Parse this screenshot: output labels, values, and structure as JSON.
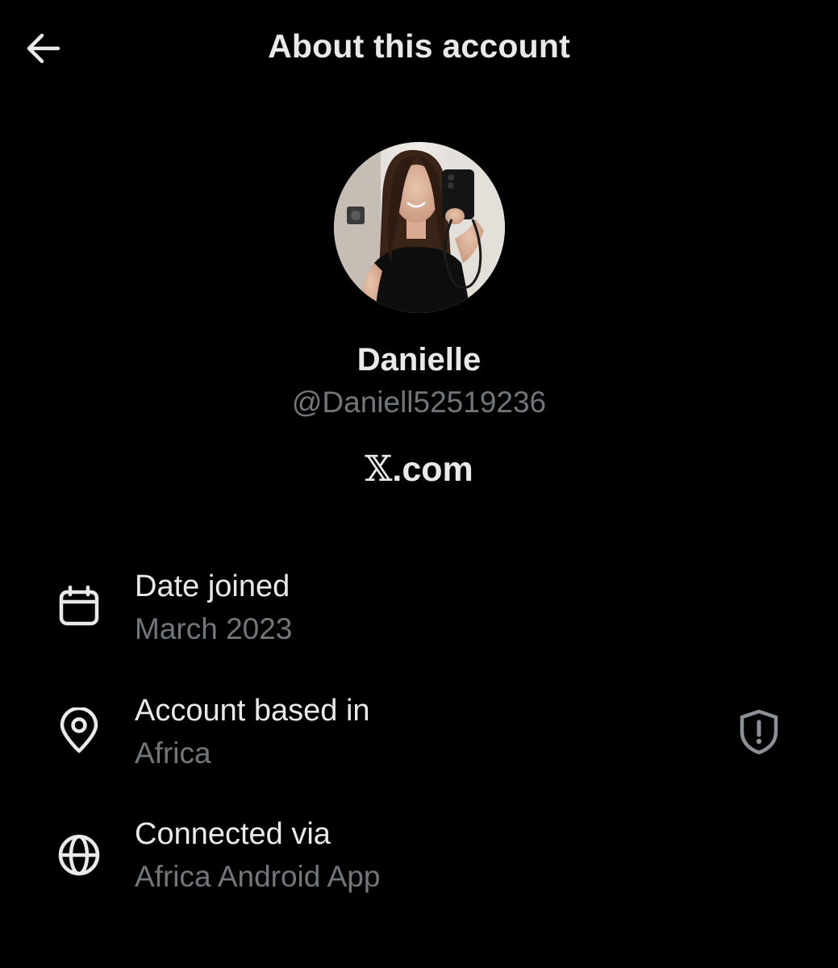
{
  "header": {
    "back_icon": "arrow-left-icon",
    "title": "About this account"
  },
  "profile": {
    "avatar_icon": "profile-photo",
    "display_name": "Danielle",
    "handle": "@Daniell52519236",
    "platform_logo": "𝕏",
    "platform_suffix": ".com"
  },
  "details": {
    "date_joined": {
      "icon": "calendar-icon",
      "label": "Date joined",
      "value": "March 2023"
    },
    "account_based_in": {
      "icon": "location-pin-icon",
      "label": "Account based in",
      "value": "Africa",
      "action_icon": "shield-alert-icon"
    },
    "connected_via": {
      "icon": "globe-icon",
      "label": "Connected via",
      "value": "Africa Android App"
    }
  },
  "colors": {
    "background": "#000000",
    "primary_text": "#e7e9ea",
    "secondary_text": "#71767b"
  }
}
